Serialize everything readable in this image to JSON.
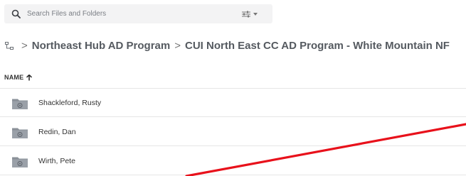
{
  "search": {
    "placeholder": "Search Files and Folders"
  },
  "breadcrumb": {
    "items": [
      {
        "label": "Northeast Hub AD Program"
      },
      {
        "label": "CUI North East CC AD Program - White Mountain NF"
      }
    ]
  },
  "table": {
    "column_name": "NAME",
    "sort_direction": "ascending",
    "rows": [
      {
        "name": "Shackleford, Rusty",
        "icon": "shared-folder-icon"
      },
      {
        "name": "Redin, Dan",
        "icon": "shared-folder-icon"
      },
      {
        "name": "Wirth, Pete",
        "icon": "shared-folder-icon"
      }
    ]
  },
  "colors": {
    "folder_gray": "#8a9098",
    "annotation_red": "#e8111b",
    "search_bg": "#f3f3f4"
  }
}
